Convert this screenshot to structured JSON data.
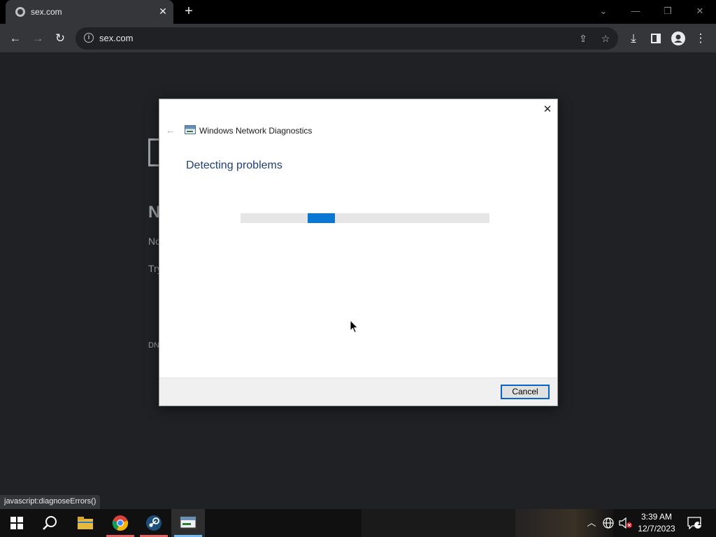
{
  "browser": {
    "tab_title": "sex.com",
    "url": "sex.com",
    "status_text": "javascript:diagnoseErrors()"
  },
  "page_background": {
    "heading_fragment": "N",
    "line1_fragment": "No",
    "line2_fragment": "Try",
    "dns_fragment": "DN"
  },
  "dialog": {
    "title": "Windows Network Diagnostics",
    "heading": "Detecting problems",
    "progress_fraction": 0.27,
    "progress_segment_fraction": 0.11,
    "cancel_label": "Cancel"
  },
  "taskbar": {
    "time": "3:39 AM",
    "date": "12/7/2023",
    "notification_count": "1"
  },
  "colors": {
    "accent": "#0878d4",
    "dialog_heading": "#1e3f7a",
    "page_bg": "#202124"
  }
}
